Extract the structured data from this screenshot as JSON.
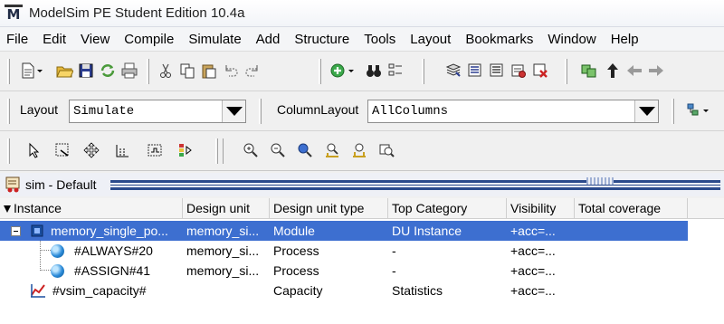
{
  "window": {
    "title": "ModelSim PE Student Edition 10.4a",
    "logo_letter": "M"
  },
  "menu": [
    "File",
    "Edit",
    "View",
    "Compile",
    "Simulate",
    "Add",
    "Structure",
    "Tools",
    "Layout",
    "Bookmarks",
    "Window",
    "Help"
  ],
  "layout_bar": {
    "layout_label": "Layout",
    "layout_value": "Simulate",
    "column_layout_label": "ColumnLayout",
    "column_layout_value": "AllColumns"
  },
  "panel": {
    "title": "sim - Default"
  },
  "table": {
    "columns": [
      "Instance",
      "Design unit",
      "Design unit type",
      "Top Category",
      "Visibility",
      "Total coverage"
    ],
    "rows": [
      {
        "instance": "memory_single_po...",
        "design_unit": "memory_si...",
        "design_unit_type": "Module",
        "top_category": "DU Instance",
        "visibility": "+acc=...",
        "total_coverage": "",
        "selected": true,
        "icon": "module-icon"
      },
      {
        "instance": "#ALWAYS#20",
        "design_unit": "memory_si...",
        "design_unit_type": "Process",
        "top_category": "-",
        "visibility": "+acc=...",
        "total_coverage": "",
        "selected": false,
        "icon": "process-icon"
      },
      {
        "instance": "#ASSIGN#41",
        "design_unit": "memory_si...",
        "design_unit_type": "Process",
        "top_category": "-",
        "visibility": "+acc=...",
        "total_coverage": "",
        "selected": false,
        "icon": "process-icon"
      },
      {
        "instance": "#vsim_capacity#",
        "design_unit": "",
        "design_unit_type": "Capacity",
        "top_category": "Statistics",
        "visibility": "+acc=...",
        "total_coverage": "",
        "selected": false,
        "icon": "capacity-icon"
      }
    ]
  },
  "colors": {
    "selection": "#3d6fd0",
    "panel_stripe": "#2b4a8b"
  }
}
